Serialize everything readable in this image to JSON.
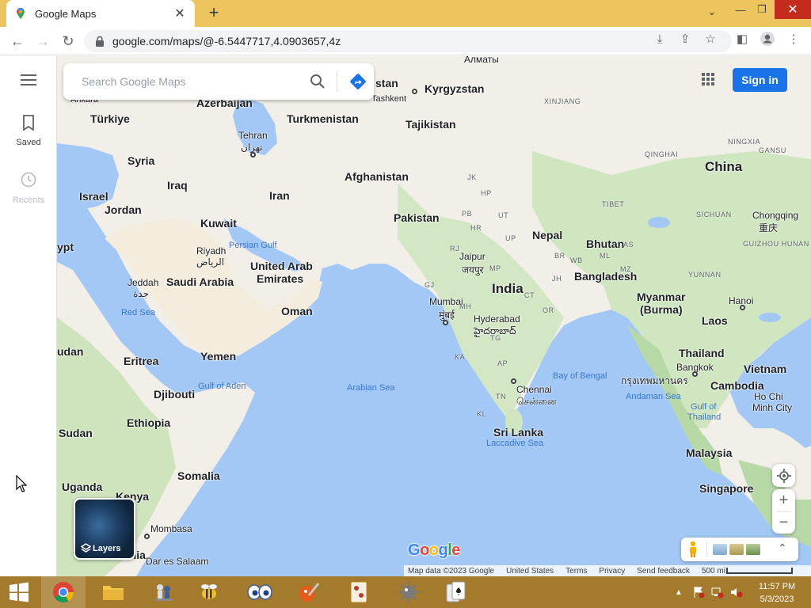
{
  "browser": {
    "tab_title": "Google Maps",
    "url": "google.com/maps/@-6.5447717,4.0903657,4z"
  },
  "sidebar": {
    "saved_label": "Saved",
    "recents_label": "Recents"
  },
  "search": {
    "placeholder": "Search Google Maps"
  },
  "header": {
    "signin_label": "Sign in"
  },
  "map": {
    "countries": {
      "kazakhstan_fragment": "stan",
      "kyrgyzstan": "Kyrgyzstan",
      "azerbaijan": "Azerbaijan",
      "turkiye": "Türkiye",
      "turkmenistan": "Turkmenistan",
      "tajikistan": "Tajikistan",
      "syria": "Syria",
      "iraq": "Iraq",
      "iran": "Iran",
      "afghanistan": "Afghanistan",
      "israel": "Israel",
      "jordan": "Jordan",
      "kuwait": "Kuwait",
      "pakistan": "Pakistan",
      "china": "China",
      "egypt_fragment": "ypt",
      "saudi_arabia": "Saudi Arabia",
      "uae_line1": "United Arab",
      "uae_line2": "Emirates",
      "nepal": "Nepal",
      "bhutan": "Bhutan",
      "india": "India",
      "bangladesh": "Bangladesh",
      "myanmar_line1": "Myanmar",
      "myanmar_line2": "(Burma)",
      "oman": "Oman",
      "laos": "Laos",
      "sudan_fragment": "udan",
      "yemen": "Yemen",
      "eritrea": "Eritrea",
      "thailand": "Thailand",
      "vietnam": "Vietnam",
      "djibouti": "Djibouti",
      "cambodia": "Cambodia",
      "ethiopia": "Ethiopia",
      "south_sudan": "Sudan",
      "sri_lanka": "Sri Lanka",
      "malaysia": "Malaysia",
      "uganda": "Uganda",
      "kenya": "Kenya",
      "somalia": "Somalia",
      "singapore": "Singapore",
      "tanzania_fragment": "Tanzania"
    },
    "cities": {
      "almaty": "Алматы",
      "tashkent": "Tashkent",
      "ankara": "Ankara",
      "tehran": "Tehran",
      "tehran_local": "تهران",
      "riyadh": "Riyadh",
      "riyadh_local": "الرياض",
      "jeddah": "Jeddah",
      "jeddah_local": "جدة",
      "jaipur": "Jaipur",
      "jaipur_local": "जयपुर",
      "mumbai": "Mumbai",
      "mumbai_local": "मुंबई",
      "hyderabad": "Hyderabad",
      "hyderabad_local": "హైదరాబాద్",
      "chennai": "Chennai",
      "chennai_local": "சென்னை",
      "chongqing": "Chongqing",
      "chongqing_local": "重庆",
      "hanoi": "Hanoi",
      "bangkok": "Bangkok",
      "bangkok_local": "กรุงเทพมหานคร",
      "hcmc_line1": "Ho Chi",
      "hcmc_line2": "Minh City",
      "mombasa": "Mombasa",
      "dar_es_salaam": "Dar es Salaam"
    },
    "regions": {
      "xinjiang": "XINJIANG",
      "qinghai": "QINGHAI",
      "ningxia": "NINGXIA",
      "gansu": "GANSU",
      "tibet": "TIBET",
      "sichuan": "SICHUAN",
      "guizhou": "GUIZHOU HUNAN",
      "yunnan": "YUNNAN",
      "jk": "JK",
      "hp": "HP",
      "pb": "PB",
      "ut": "UT",
      "hr": "HR",
      "up": "UP",
      "rj": "RJ",
      "gj": "GJ",
      "mp": "MP",
      "br": "BR",
      "jh": "JH",
      "wb": "WB",
      "mz": "MZ",
      "ml": "ML",
      "as": "AS",
      "mh": "MH",
      "ct": "CT",
      "or": "OR",
      "tg": "TG",
      "ap": "AP",
      "ka": "KA",
      "tn": "TN",
      "kl": "KL"
    },
    "waters": {
      "persian_gulf": "Persian Gulf",
      "red_sea": "Red Sea",
      "gulf_of_aden": "Gulf of Aden",
      "arabian_sea": "Arabian Sea",
      "bay_of_bengal": "Bay of Bengal",
      "andaman_sea": "Andaman Sea",
      "gulf_thailand_line1": "Gulf of",
      "gulf_thailand_line2": "Thailand",
      "laccadive_sea": "Laccadive Sea"
    },
    "layers_label": "Layers",
    "logo": [
      "G",
      "o",
      "o",
      "g",
      "l",
      "e"
    ],
    "logo_colors": [
      "#4285f4",
      "#ea4335",
      "#fbbc05",
      "#4285f4",
      "#34a853",
      "#ea4335"
    ]
  },
  "footer": {
    "map_data": "Map data ©2023 Google",
    "country": "United States",
    "terms": "Terms",
    "privacy": "Privacy",
    "feedback": "Send feedback",
    "scale": "500 mi"
  },
  "taskbar": {
    "time": "11:57 PM",
    "date": "5/3/2023"
  },
  "colors": {
    "water": "#a3c8f5",
    "land": "#f2efe9",
    "green": "#b5d6a7",
    "accent": "#1a73e8",
    "taskbar": "#a47a2c"
  }
}
